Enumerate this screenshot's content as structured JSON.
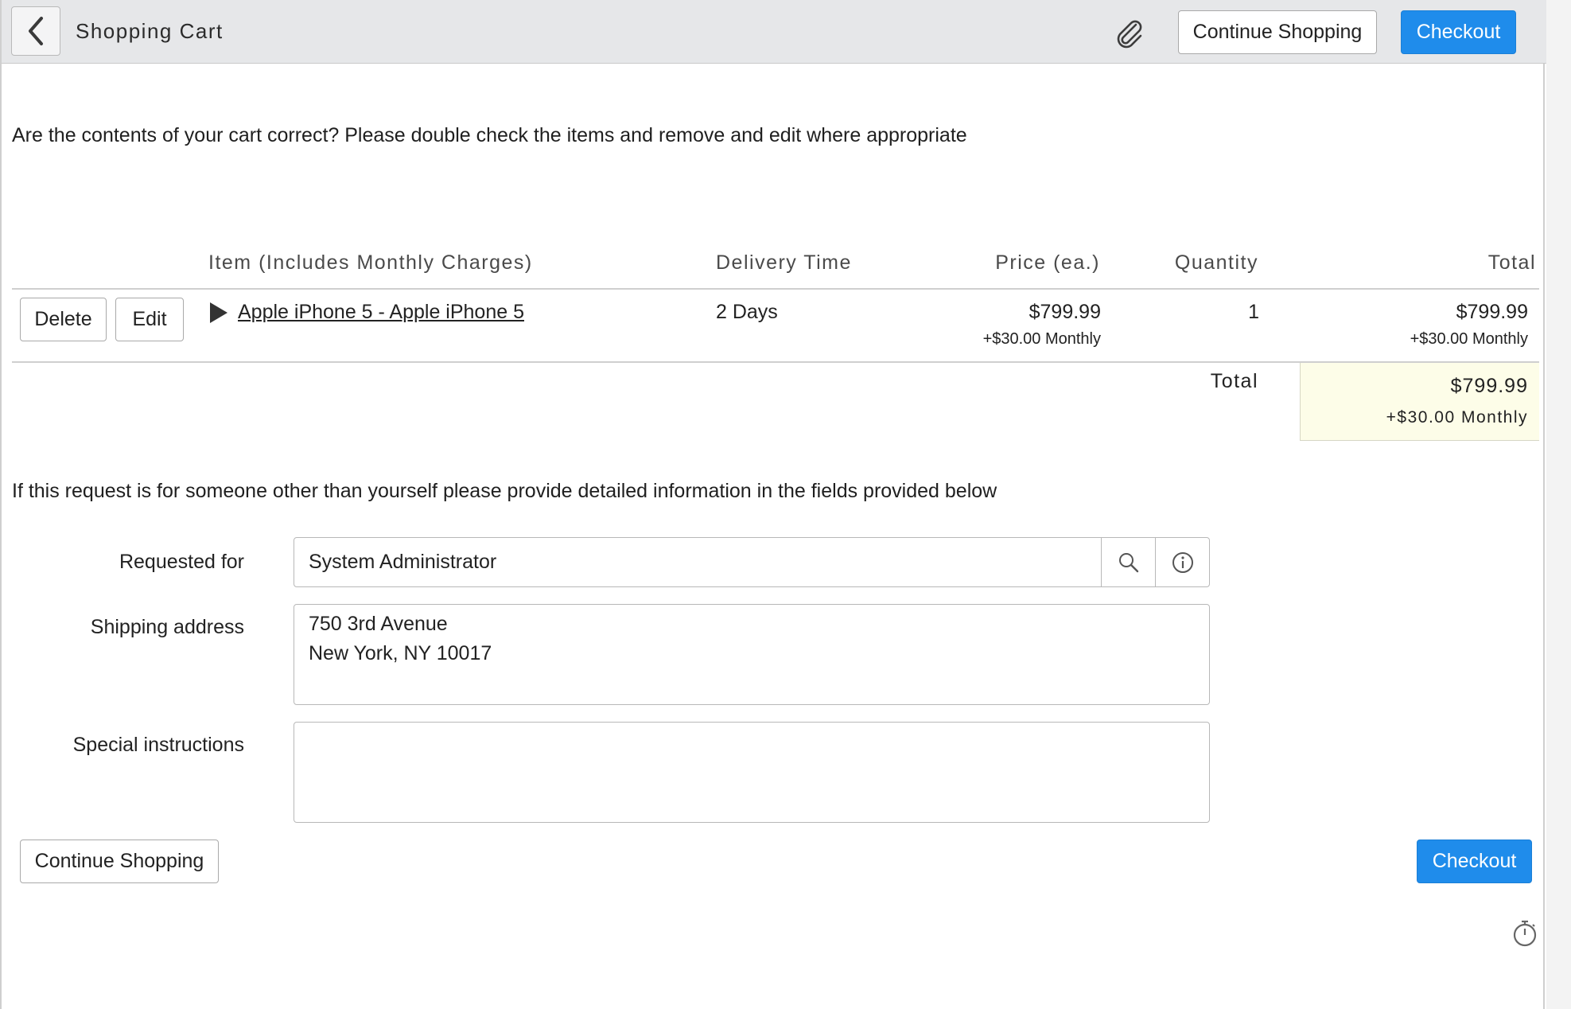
{
  "header": {
    "title": "Shopping Cart",
    "continue_label": "Continue Shopping",
    "checkout_label": "Checkout"
  },
  "intro_text": "Are the contents of your cart correct? Please double check the items and remove and edit where appropriate",
  "table": {
    "columns": [
      "Item (Includes Monthly Charges)",
      "Delivery Time",
      "Price (ea.)",
      "Quantity",
      "Total"
    ],
    "rows": [
      {
        "delete_label": "Delete",
        "edit_label": "Edit",
        "item": "Apple iPhone 5 - Apple iPhone 5",
        "delivery": "2 Days",
        "price": "$799.99",
        "price_monthly": "+$30.00 Monthly",
        "quantity": "1",
        "total": "$799.99",
        "total_monthly": "+$30.00 Monthly"
      }
    ],
    "grand_total_label": "Total",
    "grand_total": "$799.99",
    "grand_total_monthly": "+$30.00 Monthly"
  },
  "request_note": "If this request is for someone other than yourself please provide detailed information in the fields provided below",
  "form": {
    "requested_for_label": "Requested for",
    "requested_for_value": "System Administrator",
    "shipping_label": "Shipping address",
    "shipping_value": "750 3rd Avenue\nNew York, NY 10017",
    "instructions_label": "Special instructions",
    "instructions_value": ""
  },
  "footer": {
    "continue_label": "Continue Shopping",
    "checkout_label": "Checkout"
  },
  "colors": {
    "primary": "#1f8ceb",
    "total_highlight": "#fdfde8",
    "header_bg": "#e6e7e9"
  },
  "icons": [
    "chevron-left-icon",
    "paperclip-icon",
    "search-icon",
    "info-icon",
    "stopwatch-icon",
    "expand-triangle-icon"
  ]
}
